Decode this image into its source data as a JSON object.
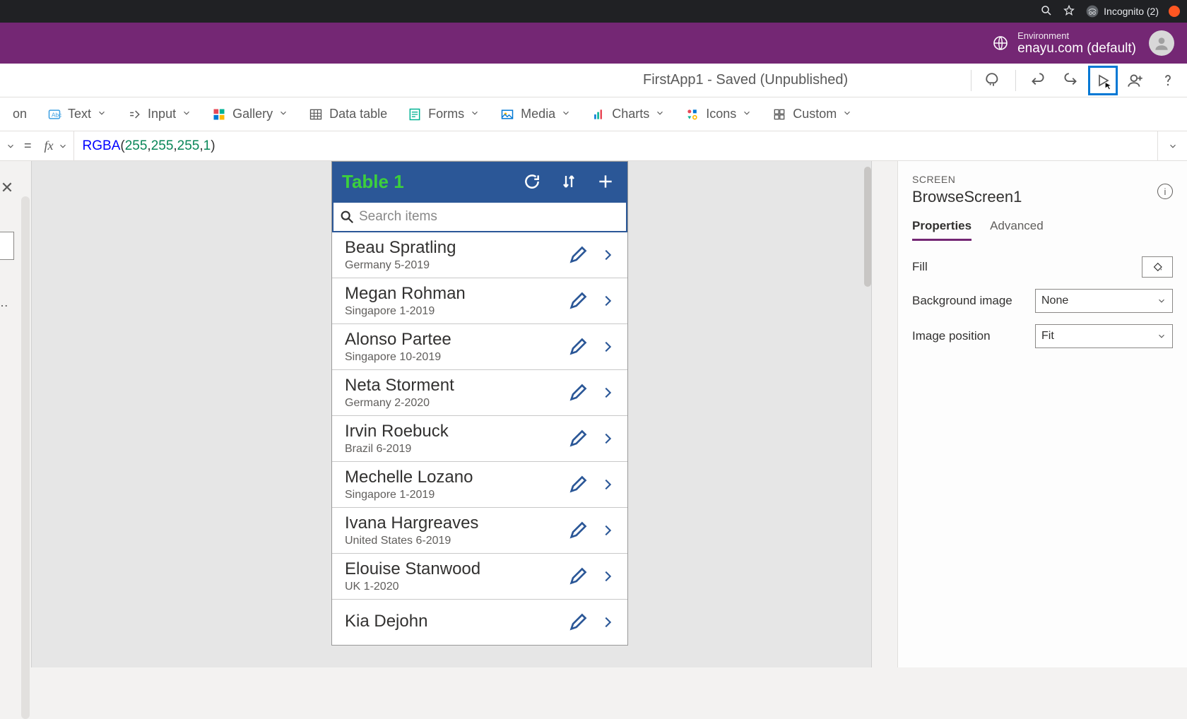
{
  "browser": {
    "incognito_label": "Incognito (2)"
  },
  "environment": {
    "label": "Environment",
    "value": "enayu.com (default)"
  },
  "app": {
    "status": "FirstApp1 - Saved (Unpublished)"
  },
  "ribbon": {
    "left_fragment": "on",
    "text": "Text",
    "input": "Input",
    "gallery": "Gallery",
    "datatable": "Data table",
    "forms": "Forms",
    "media": "Media",
    "charts": "Charts",
    "icons": "Icons",
    "custom": "Custom"
  },
  "formula": {
    "eq": "=",
    "fn": "RGBA",
    "open": "(",
    "a1": "255",
    "c": ", ",
    "a2": "255",
    "a3": "255",
    "a4": "1",
    "close": ")"
  },
  "preview": {
    "title": "Table 1",
    "search_placeholder": "Search items",
    "rows": [
      {
        "title": "Beau Spratling",
        "sub": "Germany 5-2019"
      },
      {
        "title": "Megan Rohman",
        "sub": "Singapore 1-2019"
      },
      {
        "title": "Alonso Partee",
        "sub": "Singapore 10-2019"
      },
      {
        "title": "Neta Storment",
        "sub": "Germany 2-2020"
      },
      {
        "title": "Irvin Roebuck",
        "sub": "Brazil 6-2019"
      },
      {
        "title": "Mechelle Lozano",
        "sub": "Singapore 1-2019"
      },
      {
        "title": "Ivana Hargreaves",
        "sub": "United States 6-2019"
      },
      {
        "title": "Elouise Stanwood",
        "sub": "UK 1-2020"
      },
      {
        "title": "Kia Dejohn",
        "sub": ""
      }
    ]
  },
  "panel": {
    "type": "SCREEN",
    "name": "BrowseScreen1",
    "tabs": {
      "properties": "Properties",
      "advanced": "Advanced"
    },
    "props": {
      "fill": "Fill",
      "bgimg": "Background image",
      "bgimg_val": "None",
      "imgpos": "Image position",
      "imgpos_val": "Fit"
    }
  }
}
